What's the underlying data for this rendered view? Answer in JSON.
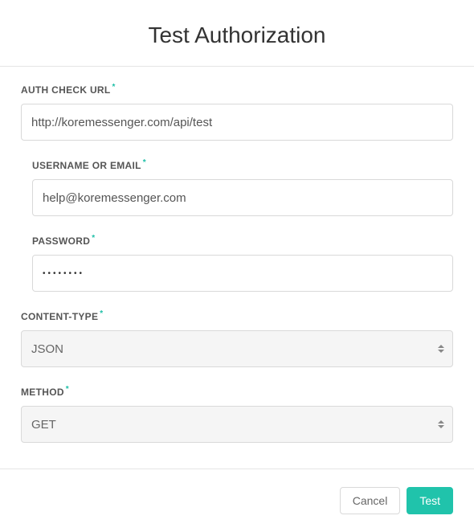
{
  "title": "Test Authorization",
  "fields": {
    "authCheckUrl": {
      "label": "AUTH CHECK URL",
      "value": "http://koremessenger.com/api/test"
    },
    "username": {
      "label": "USERNAME OR EMAIL",
      "value": "help@koremessenger.com"
    },
    "password": {
      "label": "PASSWORD",
      "mask": "••••••••"
    },
    "contentType": {
      "label": "CONTENT-TYPE",
      "value": "JSON"
    },
    "method": {
      "label": "METHOD",
      "value": "GET"
    }
  },
  "requiredMark": "*",
  "footer": {
    "cancel": "Cancel",
    "test": "Test"
  }
}
